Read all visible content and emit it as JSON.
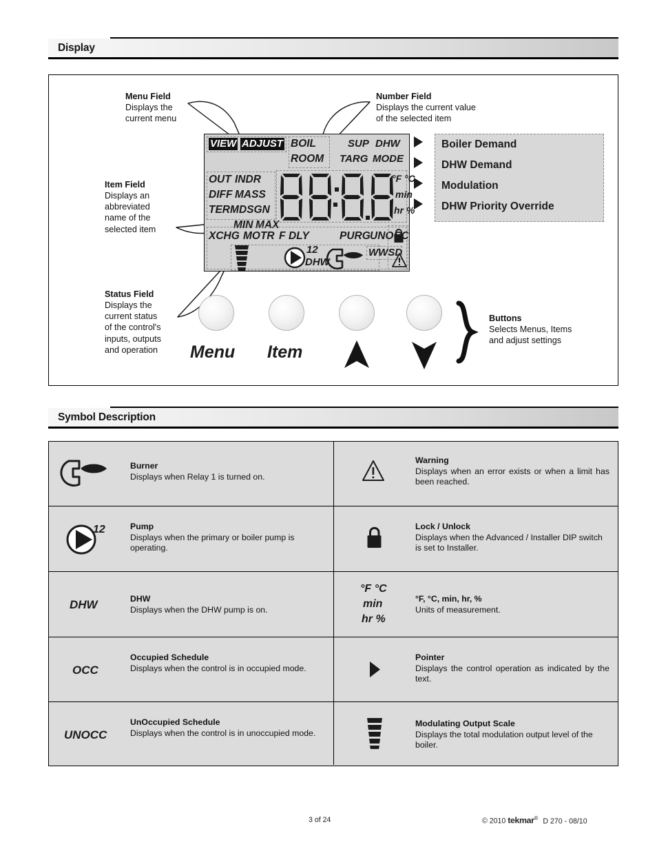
{
  "sections": {
    "display": {
      "title": "Display"
    },
    "symbols": {
      "title": "Symbol Description"
    }
  },
  "callouts": {
    "menu_field": {
      "title": "Menu Field",
      "body": "Displays the\ncurrent menu"
    },
    "item_field": {
      "title": "Item Field",
      "body": "Displays an\nabbreviated\nname of the\nselected item"
    },
    "status_field": {
      "title": "Status Field",
      "body": "Displays the\ncurrent status\nof the control's\ninputs, outputs\nand operation"
    },
    "number_field": {
      "title": "Number Field",
      "body": "Displays the current value\nof the selected item"
    },
    "buttons": {
      "title": "Buttons",
      "body": "Selects Menus, Items\nand adjust settings"
    }
  },
  "lcd": {
    "menu_row": {
      "view": "VIEW",
      "adjust": "ADJUST",
      "boil": "BOIL",
      "room": "ROOM"
    },
    "top_right": {
      "sup": "SUP",
      "dhw": "DHW",
      "targ": "TARG",
      "mode": "MODE"
    },
    "item_rows": [
      {
        "a": "OUT",
        "b": "INDR"
      },
      {
        "a": "DIFF",
        "b": "MASS"
      },
      {
        "a": "TERM",
        "b": "DSGN"
      },
      {
        "a": "MIN",
        "b": "MAX"
      }
    ],
    "status_row": {
      "xchg": "XCHG",
      "motr": "MOTR",
      "f": "F",
      "dly": "DLY",
      "purg": "PURG",
      "unocc": "UNOCC"
    },
    "digits": "88:8.8",
    "units": [
      "°F °C",
      "min",
      "hr %"
    ],
    "bottom": {
      "pump_num": "12",
      "dhw": "DHW",
      "wwsd": "WWSD"
    },
    "pointer_labels": [
      "Boiler Demand",
      "DHW Demand",
      "Modulation",
      "DHW Priority Override"
    ]
  },
  "buttons": [
    {
      "label": "Menu",
      "kind": "text"
    },
    {
      "label": "Item",
      "kind": "text"
    },
    {
      "label": "Up",
      "kind": "up-arrow"
    },
    {
      "label": "Down",
      "kind": "down-arrow"
    }
  ],
  "symbol_table": [
    {
      "left": {
        "icon": "burner-icon",
        "word": "",
        "title": "Burner",
        "desc": "Displays when Relay 1 is turned on."
      },
      "right": {
        "icon": "warning-icon",
        "word": "",
        "title": "Warning",
        "desc": "Displays when an error exists or when a limit has been reached."
      }
    },
    {
      "left": {
        "icon": "pump-icon",
        "word": "",
        "title": "Pump",
        "desc": "Displays when the primary or boiler pump is operating."
      },
      "right": {
        "icon": "lock-icon",
        "word": "",
        "title": "Lock / Unlock",
        "desc": "Displays when the Advanced / Installer DIP switch is set to Installer."
      }
    },
    {
      "left": {
        "icon": "dhw-text-icon",
        "word": "DHW",
        "title": "DHW",
        "desc": "Displays when the DHW pump is on."
      },
      "right": {
        "icon": "units-text-icon",
        "word": "°F °C|min|hr %",
        "title": "°F, °C, min, hr, %",
        "desc": "Units of measurement."
      }
    },
    {
      "left": {
        "icon": "occ-text-icon",
        "word": "OCC",
        "title": "Occupied Schedule",
        "desc": "Displays when the control is in occupied mode."
      },
      "right": {
        "icon": "pointer-icon",
        "word": "",
        "title": "Pointer",
        "desc": "Displays the control operation as indicated by the text."
      }
    },
    {
      "left": {
        "icon": "unocc-text-icon",
        "word": "UNOCC",
        "title": "UnOccupied Schedule",
        "desc": "Displays when the control is in unoccupied mode."
      },
      "right": {
        "icon": "modulating-scale-icon",
        "word": "",
        "title": "Modulating Output Scale",
        "desc": "Displays the total modulation output level of the boiler."
      }
    }
  ],
  "footer": {
    "page": "3 of 24",
    "copyright": "© 2010",
    "brand": "tekmar",
    "registered": "®",
    "doc": "D 270 - 08/10"
  },
  "colors": {
    "lcd_background": "#d3d3d3",
    "lcd_segment": "#1b1b1b",
    "table_background": "#dcdcdc",
    "rule": "#000000"
  }
}
